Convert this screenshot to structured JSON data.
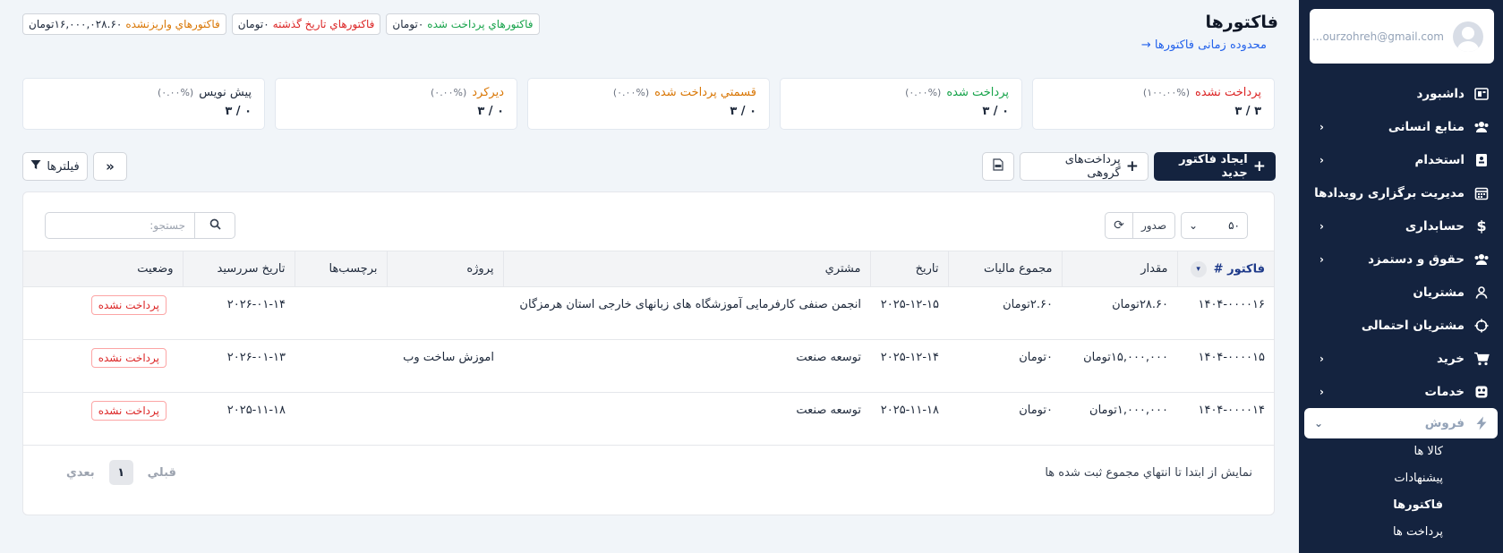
{
  "sidebar": {
    "user_email": "...ourzohreh@gmail.com",
    "items": [
      {
        "label": "داشبورد",
        "icon": "dashboard-icon",
        "chevron": false
      },
      {
        "label": "منابع انسانی",
        "icon": "users-icon",
        "chevron": true
      },
      {
        "label": "استخدام",
        "icon": "id-card-icon",
        "chevron": true
      },
      {
        "label": "مدیریت برگزاری رویدادها",
        "icon": "calendar-icon",
        "chevron": false
      },
      {
        "label": "حسابداری",
        "icon": "dollar-icon",
        "chevron": true
      },
      {
        "label": "حقوق و دستمزد",
        "icon": "payroll-users-icon",
        "chevron": true
      },
      {
        "label": "مشتریان",
        "icon": "user-icon",
        "chevron": false
      },
      {
        "label": "مشتریان احتمالی",
        "icon": "crosshair-icon",
        "chevron": false
      },
      {
        "label": "خرید",
        "icon": "cart-icon",
        "chevron": true
      },
      {
        "label": "خدمات",
        "icon": "services-icon",
        "chevron": true
      },
      {
        "label": "فروش",
        "icon": "bolt-icon",
        "chevron": true
      }
    ],
    "sub_items": [
      "کالا ها",
      "پیشنهادات",
      "فاکتورها",
      "پرداخت ها"
    ]
  },
  "header": {
    "title": "فاکتورها",
    "range_link": "محدوده زمانی فاکتورها",
    "range_arrow": "→"
  },
  "summary": {
    "paid": {
      "label": "فاکتورهاي پرداخت شده",
      "amount": "۰تومان"
    },
    "overdue": {
      "label": "فاکتورهاي تاريخ گذشته",
      "amount": "۰تومان"
    },
    "unpaid": {
      "label": "فاکتورهاي واريزنشده",
      "amount": "۱۶,۰۰۰,۰۲۸.۶۰تومان"
    }
  },
  "stats": [
    {
      "label": "پرداخت نشده",
      "percent": "(۱۰۰.۰۰%)",
      "count": "۳ / ۳",
      "color": "#dc2626"
    },
    {
      "label": "پرداخت شده",
      "percent": "(۰.۰۰%)",
      "count": "۰ / ۳",
      "color": "#16a34a"
    },
    {
      "label": "قسمتي پرداخت شده",
      "percent": "(۰.۰۰%)",
      "count": "۰ / ۳",
      "color": "#d97706"
    },
    {
      "label": "ديرکرد",
      "percent": "(۰.۰۰%)",
      "count": "۰ / ۳",
      "color": "#d97706"
    },
    {
      "label": "پيش نويس",
      "percent": "(۰.۰۰%)",
      "count": "۰ / ۳",
      "color": "#1e293b"
    }
  ],
  "toolbar": {
    "create_label": "ایجاد فاکتور جدید",
    "batch_label": "پرداخت‌های گروهی",
    "filters_label": "فیلترها"
  },
  "table": {
    "search_placeholder": "جستجو:",
    "page_length": "۵۰",
    "export_label": "صدور",
    "columns": [
      "فاکتور #",
      "مقدار",
      "مجموع ماليات",
      "تاريخ",
      "مشتري",
      "پروژه",
      "برچسب‌ها",
      "تاريخ سررسيد",
      "وضعيت"
    ],
    "rows": [
      {
        "id": "۱۴۰۴-۰۰۰۰۱۶",
        "amount": "۲۸.۶۰تومان",
        "tax": "۲.۶۰تومان",
        "date": "۲۰۲۵-۱۲-۱۵",
        "customer": "انجمن صنفی کارفرمایی آموزشگاه های زبانهای خارجی استان هرمزگان",
        "project": "",
        "tags": "",
        "due": "۲۰۲۶-۰۱-۱۴",
        "status": "پرداخت نشده"
      },
      {
        "id": "۱۴۰۴-۰۰۰۰۱۵",
        "amount": "۱۵,۰۰۰,۰۰۰تومان",
        "tax": "۰تومان",
        "date": "۲۰۲۵-۱۲-۱۴",
        "customer": "توسعه صنعت",
        "project": "اموزش ساخت وب",
        "tags": "",
        "due": "۲۰۲۶-۰۱-۱۳",
        "status": "پرداخت نشده"
      },
      {
        "id": "۱۴۰۴-۰۰۰۰۱۴",
        "amount": "۱,۰۰۰,۰۰۰تومان",
        "tax": "۰تومان",
        "date": "۲۰۲۵-۱۱-۱۸",
        "customer": "توسعه صنعت",
        "project": "",
        "tags": "",
        "due": "۲۰۲۵-۱۱-۱۸",
        "status": "پرداخت نشده"
      }
    ],
    "info": "نمایش از ابتدا تا انتهاي مجموع ثبت شده ها",
    "pagination": {
      "prev": "قبلي",
      "current": "۱",
      "next": "بعدي"
    }
  },
  "colors": {
    "sidebar_bg": "#14233f",
    "accent": "#14233f",
    "danger": "#dc2626",
    "success": "#16a34a",
    "warning": "#d97706",
    "link": "#2563eb"
  }
}
